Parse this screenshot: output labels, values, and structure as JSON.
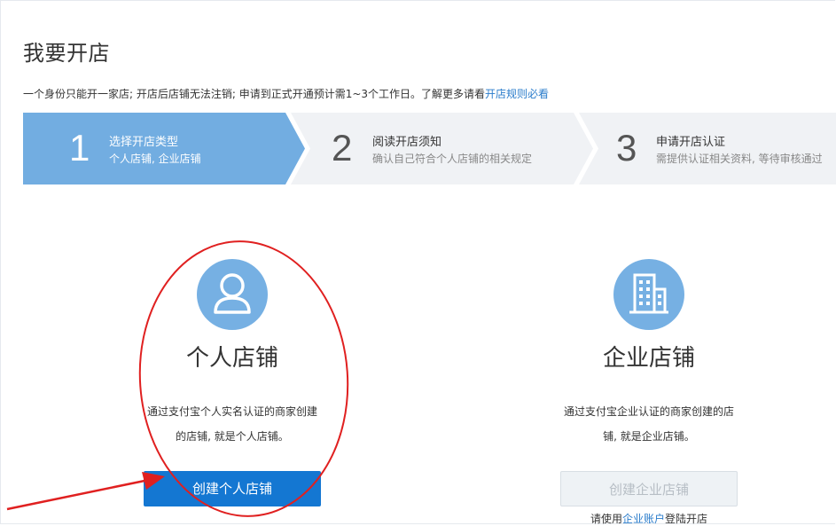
{
  "page": {
    "title": "我要开店",
    "notice_prefix": "一个身份只能开一家店; 开店后店铺无法注销; 申请到正式开通预计需1~3个工作日。了解更多请看",
    "notice_link": "开店规则必看"
  },
  "steps": [
    {
      "number": "1",
      "title": "选择开店类型",
      "desc": "个人店铺, 企业店铺",
      "active": true
    },
    {
      "number": "2",
      "title": "阅读开店须知",
      "desc": "确认自己符合个人店铺的相关规定",
      "active": false
    },
    {
      "number": "3",
      "title": "申请开店认证",
      "desc": "需提供认证相关资料, 等待审核通过",
      "active": false
    }
  ],
  "personal": {
    "name": "个人店铺",
    "desc_line1": "通过支付宝个人实名认证的商家创建",
    "desc_line2": "的店铺, 就是个人店铺。",
    "button": "创建个人店铺",
    "icon": "user-icon"
  },
  "enterprise": {
    "name": "企业店铺",
    "desc_line1": "通过支付宝企业认证的商家创建的店",
    "desc_line2": "铺, 就是企业店铺。",
    "button": "创建企业店铺",
    "footnote_prefix": "请使用",
    "footnote_link": "企业账户",
    "footnote_suffix": "登陆开店",
    "icon": "building-icon"
  },
  "colors": {
    "step_active": "#72ade1",
    "step_inactive": "#f0f2f5",
    "icon_circle": "#76b0e3",
    "primary_button": "#1477d2",
    "link": "#2a7ccb",
    "annotation": "#e02020"
  }
}
